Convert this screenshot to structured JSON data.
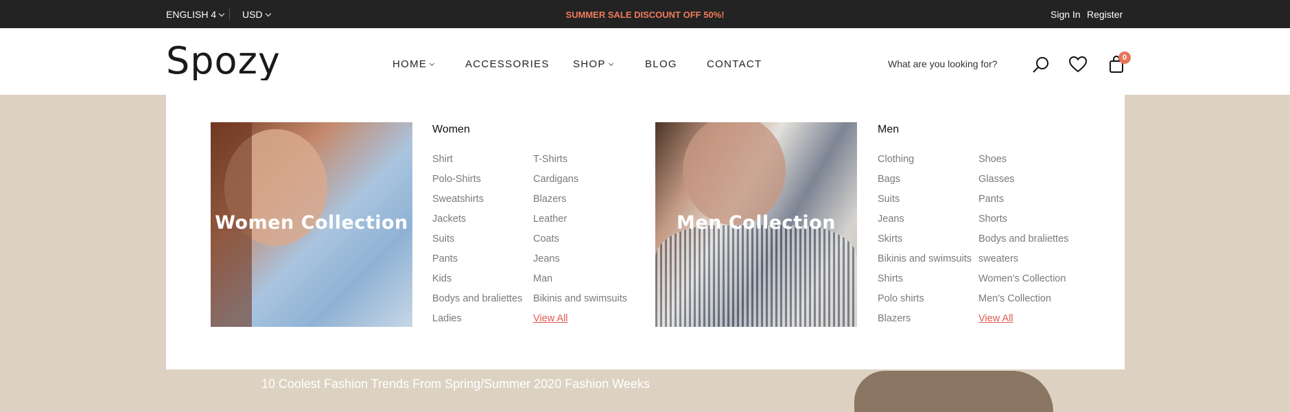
{
  "topbar": {
    "language": "ENGLISH 4",
    "currency": "USD",
    "promo": "SUMMER SALE DISCOUNT OFF 50%!",
    "sign_in": "Sign In",
    "register": "Register"
  },
  "header": {
    "logo": "Spozy",
    "nav": [
      {
        "label": "HOME",
        "dropdown": true
      },
      {
        "label": "ACCESSORIES",
        "dropdown": false
      },
      {
        "label": "SHOP",
        "dropdown": true
      },
      {
        "label": "BLOG",
        "dropdown": false
      },
      {
        "label": "CONTACT",
        "dropdown": false
      }
    ],
    "search_placeholder": "What are you looking for?",
    "cart_count": "0"
  },
  "mega_menu": {
    "women": {
      "image_caption": "Women Collection",
      "title": "Women",
      "col1": [
        "Shirt",
        "Polo-Shirts",
        "Sweatshirts",
        "Jackets",
        "Suits",
        "Pants",
        "Kids",
        "Bodys and braliettes",
        "Ladies"
      ],
      "col2": [
        "T-Shirts",
        "Cardigans",
        "Blazers",
        "Leather",
        "Coats",
        "Jeans",
        "Man",
        "Bikinis and swimsuits",
        "View All"
      ]
    },
    "men": {
      "image_caption": "Men Collection",
      "title": "Men",
      "col1": [
        "Clothing",
        "Bags",
        "Suits",
        "Jeans",
        "Skirts",
        "Bikinis and swimsuits",
        "Shirts",
        "Polo shirts",
        "Blazers"
      ],
      "col2": [
        "Shoes",
        "Glasses",
        "Pants",
        "Shorts",
        "Bodys and braliettes",
        "sweaters",
        "Women's Collection",
        "Men's Collection",
        "View All"
      ]
    }
  },
  "hero": {
    "subtitle": "10 Coolest Fashion Trends From Spring/Summer 2020 Fashion Weeks"
  },
  "colors": {
    "topbar_bg": "#232323",
    "promo": "#ef7b5b",
    "hero_bg": "#ddd2c2",
    "view_all": "#e05a50",
    "cart_badge": "#e5755a"
  }
}
